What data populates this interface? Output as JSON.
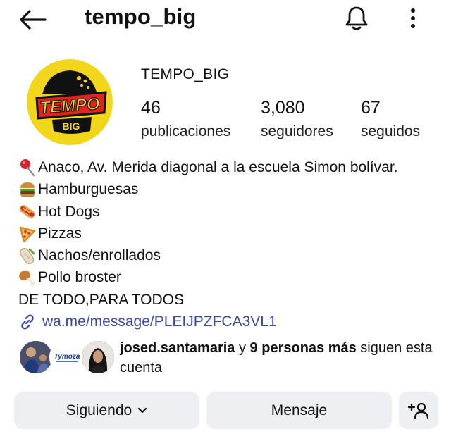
{
  "header": {
    "back_icon": "arrow-left-icon",
    "username": "tempo_big",
    "bell_icon": "bell-icon",
    "more_icon": "more-vertical-icon"
  },
  "profile": {
    "avatar_text": "TEMPO",
    "avatar_subtext": "BIG",
    "display_name": "TEMPO_BIG",
    "stats": {
      "posts": {
        "value": "46",
        "label": "publicaciones"
      },
      "followers": {
        "value": "3,080",
        "label": "seguidores"
      },
      "following": {
        "value": "67",
        "label": "seguidos"
      }
    }
  },
  "bio": {
    "location": {
      "icon": "pin-icon",
      "text": "Anaco, Av. Merida diagonal a la escuela Simon bolívar."
    },
    "items": [
      {
        "icon": "burger-icon",
        "text": "Hamburguesas"
      },
      {
        "icon": "hotdog-icon",
        "text": "Hot Dogs"
      },
      {
        "icon": "pizza-icon",
        "text": "Pizzas"
      },
      {
        "icon": "burrito-icon",
        "text": "Nachos/enrollados"
      },
      {
        "icon": "drumstick-icon",
        "text": "Pollo broster"
      }
    ],
    "tagline": "DE TODO,PARA TODOS",
    "link": {
      "icon": "link-icon",
      "text": "wa.me/message/PLEIJPZFCA3VL1"
    }
  },
  "followed_by": {
    "user": "josed.santamaria",
    "connector": " y ",
    "others": "9 personas más",
    "suffix": " siguen esta cuenta",
    "mini_avatar_logo_text": "Tymoza"
  },
  "actions": {
    "following_label": "Siguiendo",
    "message_label": "Mensaje",
    "add_user_icon": "add-user-icon"
  },
  "colors": {
    "link": "#3a4a9b",
    "button_bg": "#eeeff3",
    "avatar_yellow": "#f2d61b",
    "avatar_red": "#e0231d"
  }
}
